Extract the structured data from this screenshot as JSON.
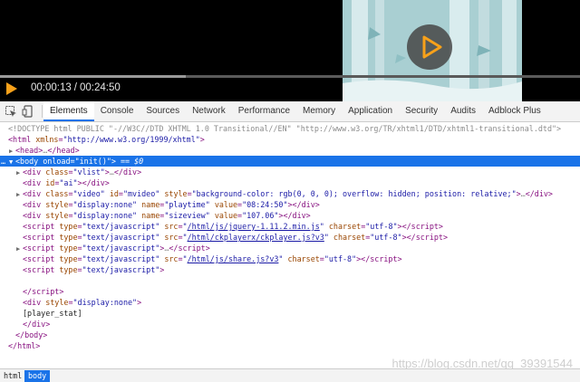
{
  "player": {
    "current_time": "00:00:13",
    "separator": "/",
    "duration": "00:24:50",
    "progress_fraction": 0.32,
    "accent_color": "#f7a11a",
    "frame_color": "#a9cfd2"
  },
  "toolbar": {
    "inspect_icon": "inspect-cursor-icon",
    "device_icon": "device-toggle-icon",
    "tabs": [
      {
        "label": "Elements",
        "selected": true
      },
      {
        "label": "Console"
      },
      {
        "label": "Sources"
      },
      {
        "label": "Network"
      },
      {
        "label": "Performance"
      },
      {
        "label": "Memory"
      },
      {
        "label": "Application"
      },
      {
        "label": "Security"
      },
      {
        "label": "Audits"
      },
      {
        "label": "Adblock Plus"
      }
    ]
  },
  "dom": {
    "doctype": "<!DOCTYPE html PUBLIC \"-//W3C//DTD XHTML 1.0 Transitional//EN\" \"http://www.w3.org/TR/xhtml1/DTD/xhtml1-transitional.dtd\">",
    "html_xmlns": "\"http://www.w3.org/1999/xhtml\"",
    "body_onload": "\"init()\"",
    "selected_marker": " == $0",
    "div_vlist_class": "\"vlist\"",
    "div_ai_id": "\"ai\"",
    "div_video_class": "\"video\"",
    "div_video_id": "\"mvideo\"",
    "div_video_style": "\"background-color: rgb(0, 0, 0); overflow: hidden; position: relative;\"",
    "playtime_style": "\"display:none\"",
    "playtime_name": "\"playtime\"",
    "playtime_value": "\"08:24:50\"",
    "sizeview_style": "\"display:none\"",
    "sizeview_name": "\"sizeview\"",
    "sizeview_value": "\"107.06\"",
    "script_type": "\"text/javascript\"",
    "script1_src": "/html/js/jquery-1.11.2.min.js",
    "script2_src": "/html/ckplayerx/ckplayer.js?v3",
    "script4_src": "/html/js/share.js?v3",
    "charset": "\"utf-8\"",
    "div_none_style": "\"display:none\"",
    "player_stat_text": "[player_stat]"
  },
  "breadcrumb": {
    "items": [
      {
        "label": "html"
      },
      {
        "label": "body",
        "selected": true
      }
    ]
  },
  "watermark": "https://blog.csdn.net/qq_39391544"
}
